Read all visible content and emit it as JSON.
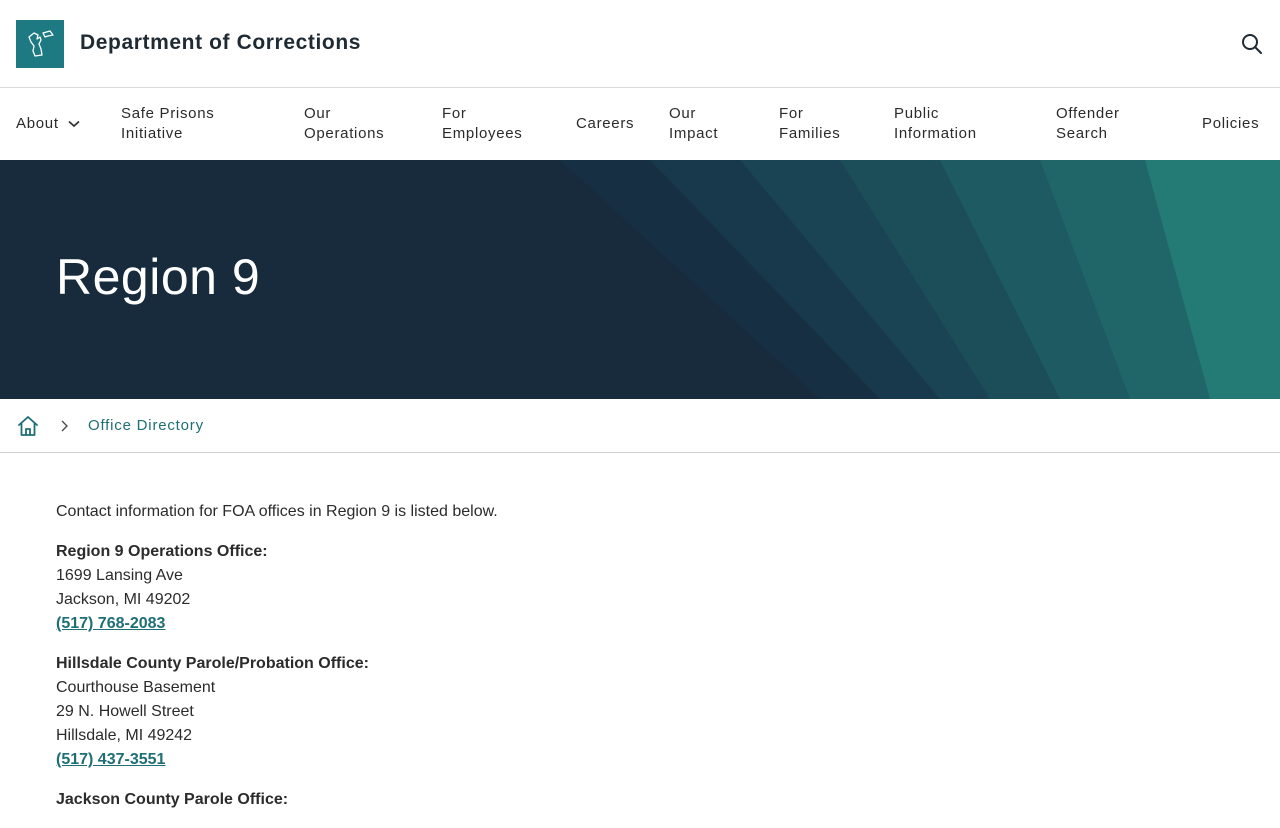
{
  "header": {
    "title": "Department of Corrections",
    "logo_icon": "michigan-state-icon",
    "search_icon": "search-icon"
  },
  "nav": {
    "items": [
      {
        "label": "About",
        "has_dropdown": true
      },
      {
        "label": "Safe Prisons\nInitiative"
      },
      {
        "label": "Our\nOperations"
      },
      {
        "label": "For\nEmployees"
      },
      {
        "label": "Careers"
      },
      {
        "label": "Our\nImpact"
      },
      {
        "label": "For\nFamilies"
      },
      {
        "label": "Public\nInformation"
      },
      {
        "label": "Offender\nSearch"
      },
      {
        "label": "Policies"
      }
    ]
  },
  "hero": {
    "title": "Region 9"
  },
  "breadcrumb": {
    "home_icon": "home-icon",
    "separator_icon": "chevron-right-icon",
    "current": "Office Directory"
  },
  "content": {
    "intro": "Contact information for FOA offices in Region 9 is listed below.",
    "offices": [
      {
        "name": "Region 9 Operations Office:",
        "lines": [
          "1699 Lansing Ave",
          "Jackson, MI  49202"
        ],
        "phone": "(517) 768-2083"
      },
      {
        "name": "Hillsdale County Parole/Probation Office:",
        "lines": [
          "Courthouse Basement",
          "29 N. Howell Street",
          "Hillsdale, MI 49242"
        ],
        "phone": "(517) 437-3551"
      },
      {
        "name": "Jackson County Parole Office:",
        "lines": [],
        "phone": ""
      }
    ]
  },
  "colors": {
    "brand_teal": "#1e7a82",
    "hero_navy": "#172b3d",
    "link": "#1e6e76"
  }
}
